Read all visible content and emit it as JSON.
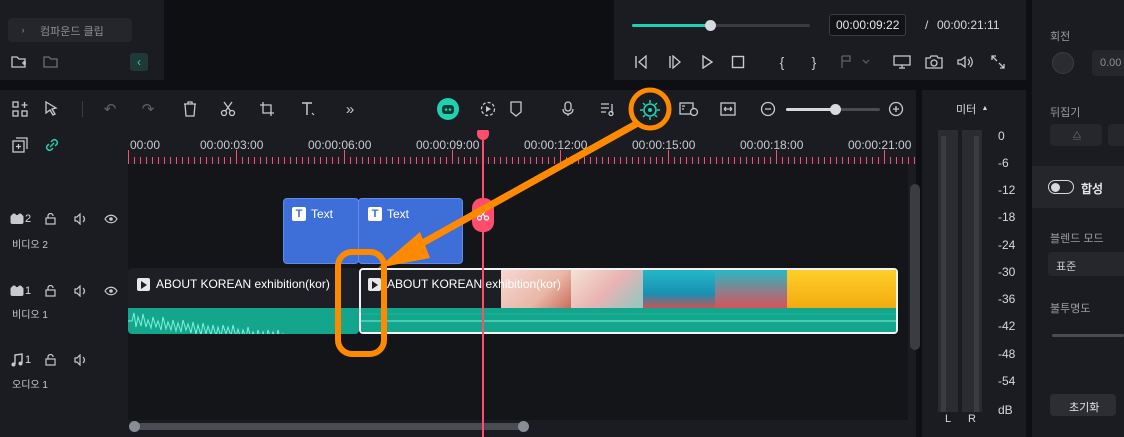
{
  "left_panel": {
    "compound_clip_label": "컴파운드 클립"
  },
  "player": {
    "progress": 0.437,
    "current_time": "00:00:09:22",
    "separator": "/",
    "total_time": "00:00:21:11"
  },
  "ruler": {
    "labels": [
      "00:00",
      "00:00:03:00",
      "00:00:06:00",
      "00:00:09:00",
      "00:00:12:00",
      "00:00:15:00",
      "00:00:18:00",
      "00:00:21:00"
    ]
  },
  "tracks": {
    "video2": {
      "number": "2",
      "name": "비디오 2"
    },
    "video1": {
      "number": "1",
      "name": "비디오 1"
    },
    "audio1": {
      "number": "1",
      "name": "오디오 1"
    }
  },
  "clips": {
    "text1": "Text",
    "text2": "Text",
    "video_clip1": "ABOUT KOREAN exhibition(kor)",
    "video_clip2": "ABOUT KOREAN exhibition(kor)"
  },
  "meter": {
    "title": "미터",
    "scale": [
      "0",
      "-6",
      "-12",
      "-18",
      "-24",
      "-30",
      "-36",
      "-42",
      "-48",
      "-54",
      "dB"
    ],
    "left_channel": "L",
    "right_channel": "R"
  },
  "right_panel": {
    "rotation_label": "회전",
    "rotation_value": "0.00",
    "flip_label": "뒤집기",
    "composite_label": "합성",
    "blend_mode_label": "블렌드 모드",
    "blend_mode_value": "표준",
    "opacity_label": "불투명도",
    "reset_button": "초기화"
  },
  "colors": {
    "accent_teal": "#1fd1b3",
    "playhead_red": "#ff4d6d",
    "text_clip_blue": "#3e6ed8",
    "annotation_orange": "#ff8a00"
  }
}
